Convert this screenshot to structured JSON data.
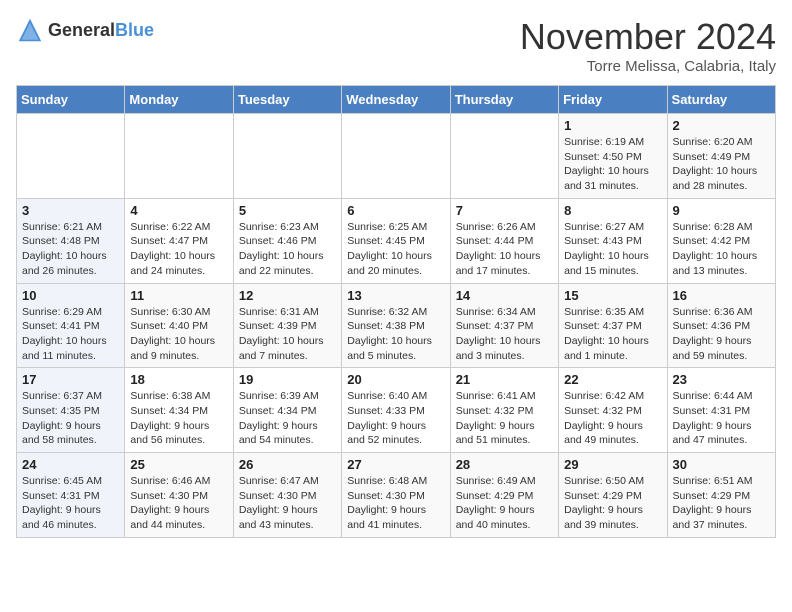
{
  "header": {
    "logo_general": "General",
    "logo_blue": "Blue",
    "month_title": "November 2024",
    "location": "Torre Melissa, Calabria, Italy"
  },
  "days_of_week": [
    "Sunday",
    "Monday",
    "Tuesday",
    "Wednesday",
    "Thursday",
    "Friday",
    "Saturday"
  ],
  "weeks": [
    [
      {
        "day": "",
        "info": ""
      },
      {
        "day": "",
        "info": ""
      },
      {
        "day": "",
        "info": ""
      },
      {
        "day": "",
        "info": ""
      },
      {
        "day": "",
        "info": ""
      },
      {
        "day": "1",
        "info": "Sunrise: 6:19 AM\nSunset: 4:50 PM\nDaylight: 10 hours and 31 minutes."
      },
      {
        "day": "2",
        "info": "Sunrise: 6:20 AM\nSunset: 4:49 PM\nDaylight: 10 hours and 28 minutes."
      }
    ],
    [
      {
        "day": "3",
        "info": "Sunrise: 6:21 AM\nSunset: 4:48 PM\nDaylight: 10 hours and 26 minutes."
      },
      {
        "day": "4",
        "info": "Sunrise: 6:22 AM\nSunset: 4:47 PM\nDaylight: 10 hours and 24 minutes."
      },
      {
        "day": "5",
        "info": "Sunrise: 6:23 AM\nSunset: 4:46 PM\nDaylight: 10 hours and 22 minutes."
      },
      {
        "day": "6",
        "info": "Sunrise: 6:25 AM\nSunset: 4:45 PM\nDaylight: 10 hours and 20 minutes."
      },
      {
        "day": "7",
        "info": "Sunrise: 6:26 AM\nSunset: 4:44 PM\nDaylight: 10 hours and 17 minutes."
      },
      {
        "day": "8",
        "info": "Sunrise: 6:27 AM\nSunset: 4:43 PM\nDaylight: 10 hours and 15 minutes."
      },
      {
        "day": "9",
        "info": "Sunrise: 6:28 AM\nSunset: 4:42 PM\nDaylight: 10 hours and 13 minutes."
      }
    ],
    [
      {
        "day": "10",
        "info": "Sunrise: 6:29 AM\nSunset: 4:41 PM\nDaylight: 10 hours and 11 minutes."
      },
      {
        "day": "11",
        "info": "Sunrise: 6:30 AM\nSunset: 4:40 PM\nDaylight: 10 hours and 9 minutes."
      },
      {
        "day": "12",
        "info": "Sunrise: 6:31 AM\nSunset: 4:39 PM\nDaylight: 10 hours and 7 minutes."
      },
      {
        "day": "13",
        "info": "Sunrise: 6:32 AM\nSunset: 4:38 PM\nDaylight: 10 hours and 5 minutes."
      },
      {
        "day": "14",
        "info": "Sunrise: 6:34 AM\nSunset: 4:37 PM\nDaylight: 10 hours and 3 minutes."
      },
      {
        "day": "15",
        "info": "Sunrise: 6:35 AM\nSunset: 4:37 PM\nDaylight: 10 hours and 1 minute."
      },
      {
        "day": "16",
        "info": "Sunrise: 6:36 AM\nSunset: 4:36 PM\nDaylight: 9 hours and 59 minutes."
      }
    ],
    [
      {
        "day": "17",
        "info": "Sunrise: 6:37 AM\nSunset: 4:35 PM\nDaylight: 9 hours and 58 minutes."
      },
      {
        "day": "18",
        "info": "Sunrise: 6:38 AM\nSunset: 4:34 PM\nDaylight: 9 hours and 56 minutes."
      },
      {
        "day": "19",
        "info": "Sunrise: 6:39 AM\nSunset: 4:34 PM\nDaylight: 9 hours and 54 minutes."
      },
      {
        "day": "20",
        "info": "Sunrise: 6:40 AM\nSunset: 4:33 PM\nDaylight: 9 hours and 52 minutes."
      },
      {
        "day": "21",
        "info": "Sunrise: 6:41 AM\nSunset: 4:32 PM\nDaylight: 9 hours and 51 minutes."
      },
      {
        "day": "22",
        "info": "Sunrise: 6:42 AM\nSunset: 4:32 PM\nDaylight: 9 hours and 49 minutes."
      },
      {
        "day": "23",
        "info": "Sunrise: 6:44 AM\nSunset: 4:31 PM\nDaylight: 9 hours and 47 minutes."
      }
    ],
    [
      {
        "day": "24",
        "info": "Sunrise: 6:45 AM\nSunset: 4:31 PM\nDaylight: 9 hours and 46 minutes."
      },
      {
        "day": "25",
        "info": "Sunrise: 6:46 AM\nSunset: 4:30 PM\nDaylight: 9 hours and 44 minutes."
      },
      {
        "day": "26",
        "info": "Sunrise: 6:47 AM\nSunset: 4:30 PM\nDaylight: 9 hours and 43 minutes."
      },
      {
        "day": "27",
        "info": "Sunrise: 6:48 AM\nSunset: 4:30 PM\nDaylight: 9 hours and 41 minutes."
      },
      {
        "day": "28",
        "info": "Sunrise: 6:49 AM\nSunset: 4:29 PM\nDaylight: 9 hours and 40 minutes."
      },
      {
        "day": "29",
        "info": "Sunrise: 6:50 AM\nSunset: 4:29 PM\nDaylight: 9 hours and 39 minutes."
      },
      {
        "day": "30",
        "info": "Sunrise: 6:51 AM\nSunset: 4:29 PM\nDaylight: 9 hours and 37 minutes."
      }
    ]
  ]
}
